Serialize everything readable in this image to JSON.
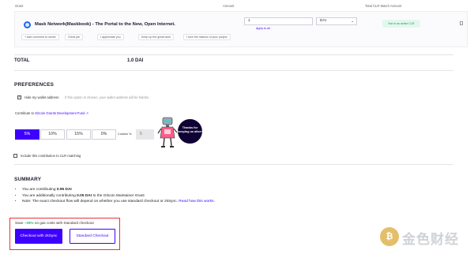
{
  "table_headers": {
    "grant": "Grant",
    "amount": "Amount",
    "clr_match": "Total CLR Match Amount"
  },
  "cart": {
    "grant_title": "Mask Network(Maskbook) - The Portal to the New, Open Internet.",
    "comment_chips": [
      "+ Add comment to owner",
      "Great job",
      "I appreciate you",
      "Keep up the great work",
      "I love the mission of your project"
    ],
    "amount_value": "1",
    "token": "DAI",
    "apply_all": "Apply to all",
    "clr_status": "Not in an active CLR"
  },
  "total": {
    "label": "TOTAL",
    "value": "1.0 DAI"
  },
  "preferences": {
    "title": "PREFERENCES",
    "hide_wallet_label": "Hide my wallet address",
    "hide_wallet_note": "If this option is chosen, your wallet address will be hidden.",
    "contribute_prefix": "Contribute to",
    "contribute_link": "Gitcoin Grants Development Fund",
    "percent_options": [
      "5%",
      "10%",
      "15%",
      "0%"
    ],
    "custom_label": "Custom %",
    "custom_value": "5",
    "bubble_text": "Thanks for keeping us alive!",
    "include_clr_label": "Include this contribution to CLR matching"
  },
  "summary": {
    "title": "SUMMARY",
    "line1_prefix": "You are contributing ",
    "line1_value": "0.95 DAI",
    "line2_prefix": "You are additionally contributing ",
    "line2_value": "0.05 DAI",
    "line2_suffix": " to the Gitcoin Maintainer Grant",
    "line3_text": "Note: The exact checkout flow will depend on whether you use standard checkout or zkSync. ",
    "line3_link": "Read how this works."
  },
  "checkout": {
    "save_prefix": "Save ",
    "save_percent": "~28%",
    "save_suffix": " on gas costs with Standard checkout",
    "zksync_button": "Checkout with zkSync",
    "standard_button": "Standard Checkout"
  },
  "watermark": {
    "text": "金色财经"
  },
  "colors": {
    "accent": "#3e00ff",
    "highlight_box": "#ee3333",
    "savings_green": "#2cba72"
  }
}
